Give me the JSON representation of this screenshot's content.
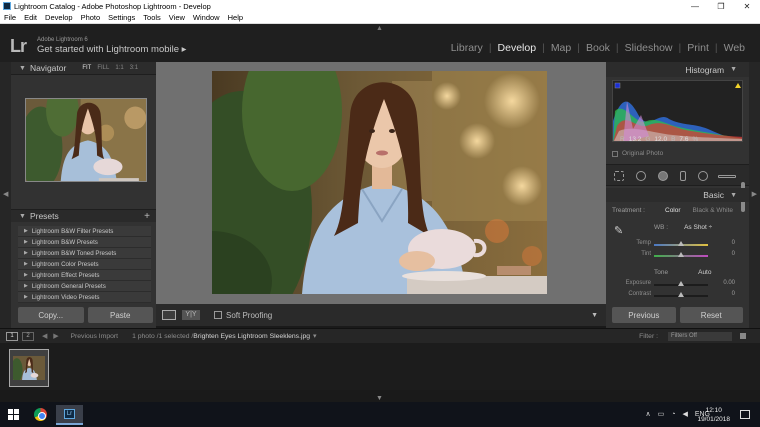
{
  "window": {
    "title": "Lightroom Catalog - Adobe Photoshop Lightroom - Develop",
    "minimize": "—",
    "maximize": "❐",
    "close": "✕"
  },
  "menu": [
    "File",
    "Edit",
    "Develop",
    "Photo",
    "Settings",
    "Tools",
    "View",
    "Window",
    "Help"
  ],
  "header": {
    "logo": "Lr",
    "version": "Adobe Lightroom 6",
    "mobile_link": "Get started with Lightroom mobile ▸"
  },
  "modules": [
    "Library",
    "Develop",
    "Map",
    "Book",
    "Slideshow",
    "Print",
    "Web"
  ],
  "active_module": "Develop",
  "navigator": {
    "title": "Navigator",
    "zoom_options": [
      "FIT",
      "FILL",
      "1:1",
      "3:1"
    ],
    "selected_zoom": "FIT"
  },
  "presets": {
    "title": "Presets",
    "items": [
      "Lightroom B&W Filter Presets",
      "Lightroom B&W Presets",
      "Lightroom B&W Toned Presets",
      "Lightroom Color Presets",
      "Lightroom Effect Presets",
      "Lightroom General Presets",
      "Lightroom Video Presets"
    ]
  },
  "left_buttons": {
    "copy": "Copy...",
    "paste": "Paste"
  },
  "toolbar": {
    "soft_proofing": "Soft Proofing",
    "yy": "Y|Y"
  },
  "histogram": {
    "title": "Histogram",
    "readout": {
      "r_label": "R",
      "r": "13.2",
      "g_label": "G",
      "g": "12.0",
      "b_label": "B",
      "b": "7.6",
      "pct": "%"
    },
    "original_photo": "Original Photo"
  },
  "basic": {
    "title": "Basic",
    "treatment_label": "Treatment :",
    "treatment_color": "Color",
    "treatment_bw": "Black & White",
    "wb_label": "WB :",
    "wb_value": "As Shot ÷",
    "temp_label": "Temp",
    "temp_value": "0",
    "tint_label": "Tint",
    "tint_value": "0",
    "tone_label": "Tone",
    "auto_label": "Auto",
    "exposure_label": "Exposure",
    "exposure_value": "0.00",
    "contrast_label": "Contrast",
    "contrast_value": "0"
  },
  "right_buttons": {
    "previous": "Previous",
    "reset": "Reset"
  },
  "filmbar": {
    "page1": "1",
    "page2": "2",
    "previous_import": "Previous Import",
    "count": "1 photo /1 selected /",
    "filename": "Brighten Eyes Lightroom Sleeklens.jpg",
    "filter_label": "Filter :",
    "filter_value": "Filters Off"
  },
  "taskbar": {
    "language": "ENG",
    "time": "12:10",
    "date": "19/01/2018"
  }
}
